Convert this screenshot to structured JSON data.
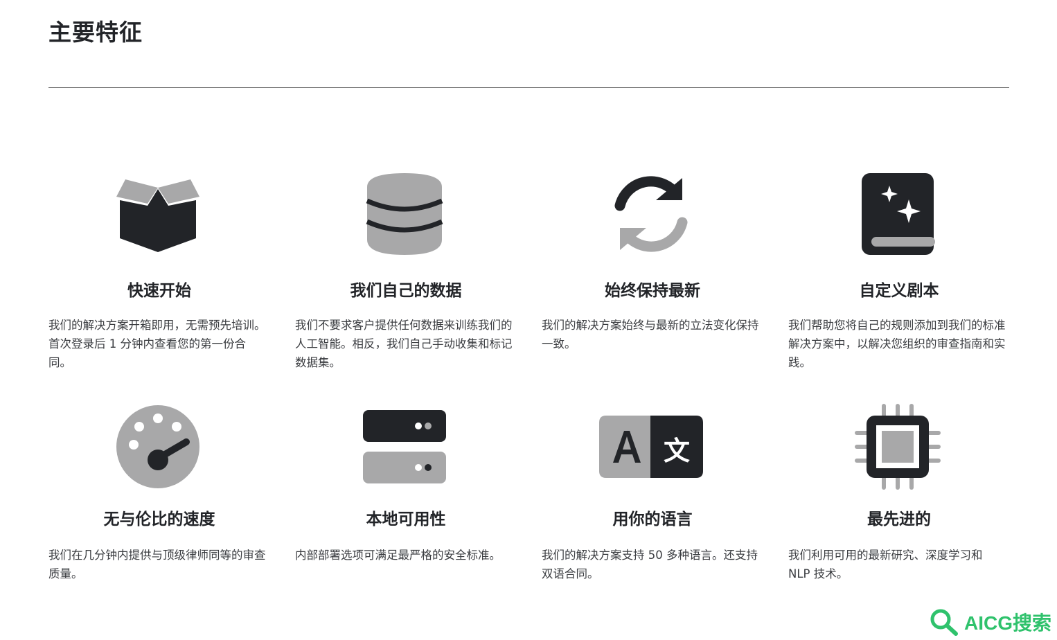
{
  "page": {
    "title": "主要特征"
  },
  "features": [
    {
      "icon": "open-box-icon",
      "title": "快速开始",
      "desc": "我们的解决方案开箱即用，无需预先培训。首次登录后 1 分钟内查看您的第一份合同。"
    },
    {
      "icon": "database-icon",
      "title": "我们自己的数据",
      "desc": "我们不要求客户提供任何数据来训练我们的人工智能。相反，我们自己手动收集和标记数据集。"
    },
    {
      "icon": "refresh-icon",
      "title": "始终保持最新",
      "desc": "我们的解决方案始终与最新的立法变化保持一致。"
    },
    {
      "icon": "sparkle-book-icon",
      "title": "自定义剧本",
      "desc": "我们帮助您将自己的规则添加到我们的标准解决方案中，以解决您组织的审查指南和实践。"
    },
    {
      "icon": "speedometer-icon",
      "title": "无与伦比的速度",
      "desc": "我们在几分钟内提供与顶级律师同等的审查质量。"
    },
    {
      "icon": "server-icon",
      "title": "本地可用性",
      "desc": "内部部署选项可满足最严格的安全标准。"
    },
    {
      "icon": "translate-icon",
      "title": "用你的语言",
      "desc": "我们的解决方案支持 50 多种语言。还支持双语合同。"
    },
    {
      "icon": "cpu-chip-icon",
      "title": "最先进的",
      "desc": "我们利用可用的最新研究、深度学习和 NLP 技术。"
    }
  ],
  "watermark": {
    "text": "AICG搜索"
  },
  "colors": {
    "dark": "#222428",
    "gray": "#a8a8a9",
    "accent": "#2fc26c"
  }
}
